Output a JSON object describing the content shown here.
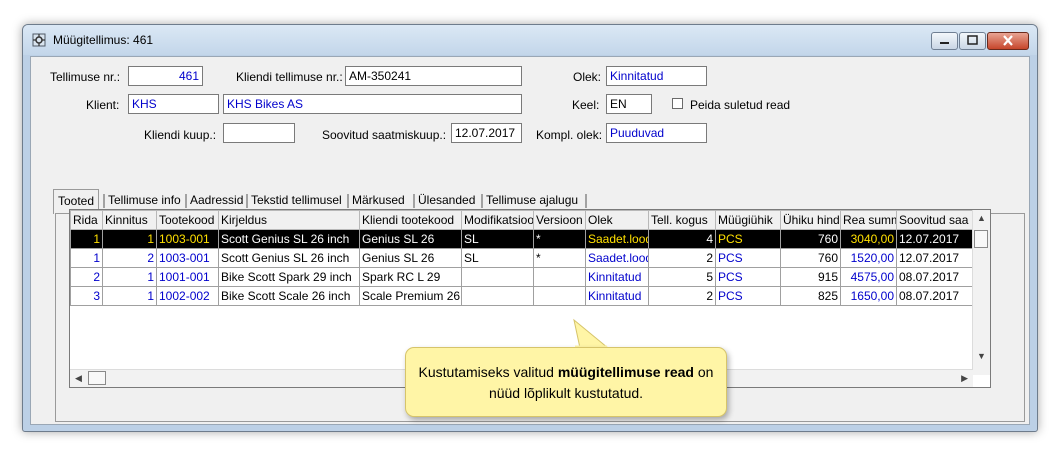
{
  "window": {
    "title": "Müügitellimus: 461"
  },
  "form": {
    "order_no_label": "Tellimuse nr.:",
    "order_no": "461",
    "client_order_label": "Kliendi tellimuse nr.:",
    "client_order": "AM-350241",
    "status_label": "Olek:",
    "status": "Kinnitatud",
    "client_label": "Klient:",
    "client_code": "KHS",
    "client_name": "KHS Bikes AS",
    "lang_label": "Keel:",
    "lang": "EN",
    "hide_closed_label": "Peida suletud read",
    "purchase_label": "Kliendi kuup.:",
    "purchase": "",
    "desired_date_label": "Soovitud saatmiskuup.:",
    "desired_date": "12.07.2017",
    "complete_status_label": "Kompl. olek:",
    "complete_status": "Puuduvad"
  },
  "tabs": [
    "Tooted",
    "Tellimuse info",
    "Aadressid",
    "Tekstid tellimusel",
    "Märkused",
    "Ülesanded",
    "Tellimuse ajalugu"
  ],
  "table": {
    "headers": [
      "Rida",
      "Kinnitus",
      "Tootekood",
      "Kirjeldus",
      "Kliendi tootekood",
      "Modifikatsioo",
      "Versioon",
      "Olek",
      "Tell. kogus",
      "Müügiühik",
      "Ühiku hind",
      "Rea summ",
      "Soovitud saa"
    ],
    "rows": [
      [
        "1",
        "1",
        "1003-001",
        "Scott Genius SL 26 inch",
        "Genius SL 26",
        "SL",
        "*",
        "Saadet.lood",
        "4",
        "PCS",
        "760",
        "3040,00",
        "12.07.2017"
      ],
      [
        "1",
        "2",
        "1003-001",
        "Scott Genius SL 26 inch",
        "Genius SL 26",
        "SL",
        "*",
        "Saadet.lood",
        "2",
        "PCS",
        "760",
        "1520,00",
        "12.07.2017"
      ],
      [
        "2",
        "1",
        "1001-001",
        "Bike Scott Spark 29 inch",
        "Spark RC L 29",
        "",
        "",
        "Kinnitatud",
        "5",
        "PCS",
        "915",
        "4575,00",
        "08.07.2017"
      ],
      [
        "3",
        "1",
        "1002-002",
        "Bike Scott Scale 26 inch",
        "Scale Premium 26",
        "",
        "",
        "Kinnitatud",
        "2",
        "PCS",
        "825",
        "1650,00",
        "08.07.2017"
      ]
    ]
  },
  "callout": {
    "text_before": "Kustutamiseks valitud ",
    "text_bold": "müügitellimuse read",
    "text_after": " on nüüd lõplikult kustutatud."
  },
  "colors": {
    "link_blue": "#0000cc",
    "selected_row": "#000000",
    "selected_text": "#ffe000",
    "callout_bg": "#fff5a6"
  }
}
